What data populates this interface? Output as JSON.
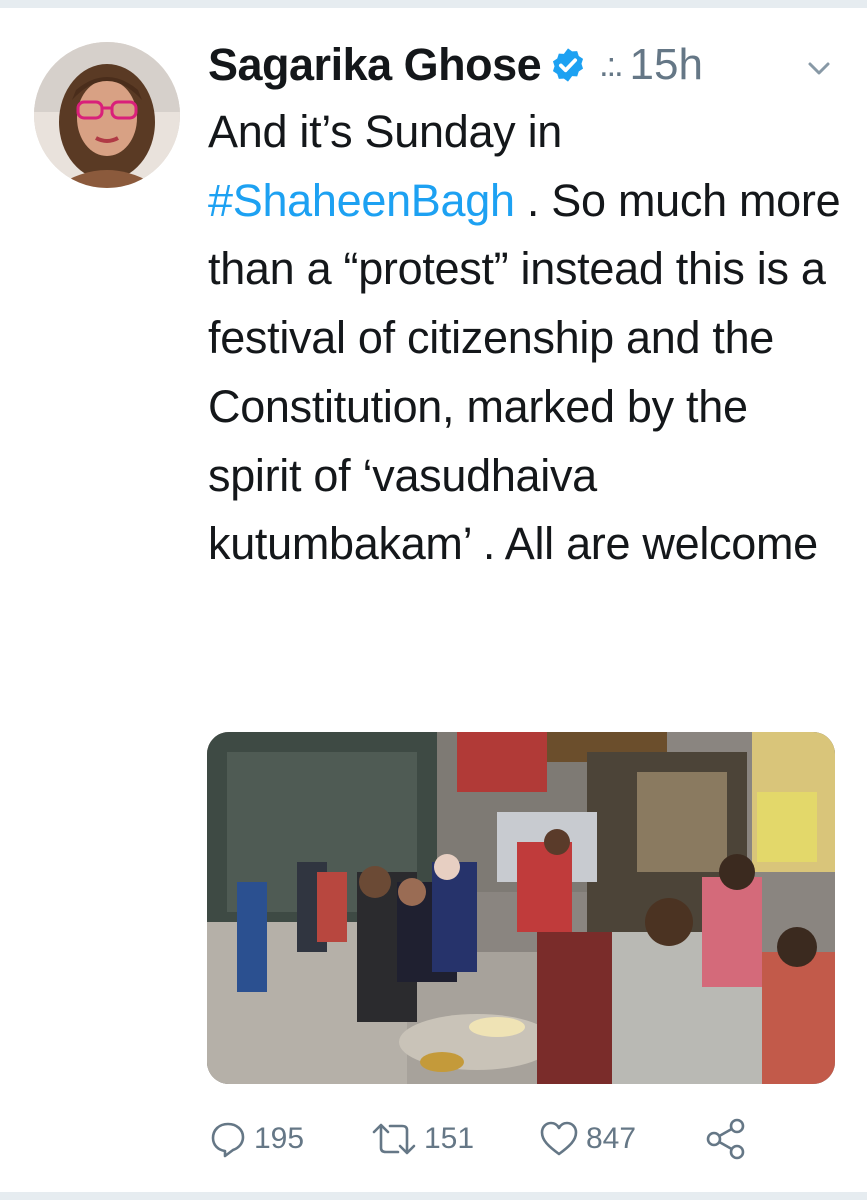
{
  "tweet": {
    "author_name": "Sagarika Ghose",
    "separator": ".:.",
    "time": "15h",
    "text_intro": "And it’s Sunday in",
    "hashtag": "#ShaheenBagh",
    "text_rest": " . So much more than a “protest” instead this is a festival of citizenship and the Constitution, marked by the spirit of ‘vasudhaiva kutumbakam’ . All are welcome",
    "verified": true
  },
  "actions": {
    "reply_count": "195",
    "retweet_count": "151",
    "like_count": "847"
  },
  "colors": {
    "link": "#1da1f2",
    "muted": "#657786",
    "text": "#14171a",
    "verified_badge": "#1da1f2"
  },
  "icons": {
    "reply": "reply-icon",
    "retweet": "retweet-icon",
    "like": "heart-icon",
    "share": "share-icon",
    "more": "chevron-down-icon",
    "verified": "verified-badge-icon"
  }
}
